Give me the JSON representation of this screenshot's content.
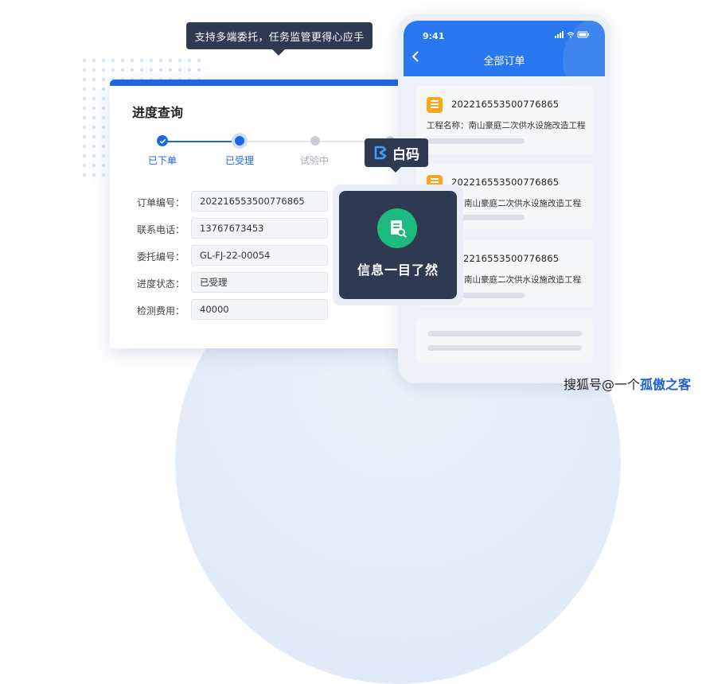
{
  "tooltip": {
    "text": "支持多端委托，任务监管更得心应手"
  },
  "progress_card": {
    "title": "进度查询",
    "steps": [
      {
        "label": "已下单",
        "state": "done"
      },
      {
        "label": "已受理",
        "state": "current"
      },
      {
        "label": "试验中",
        "state": "pending"
      }
    ],
    "fields": [
      {
        "label": "订单编号：",
        "value": "202216553500776865"
      },
      {
        "label": "联系电话：",
        "value": "13767673453"
      },
      {
        "label": "委托编号：",
        "value": "GL-FJ-22-00054"
      },
      {
        "label": "进度状态：",
        "value": "已受理"
      },
      {
        "label": "检测费用：",
        "value": "40000"
      }
    ]
  },
  "brand": {
    "name": "白码"
  },
  "info_card": {
    "text": "信息一目了然",
    "icon": "document-search-icon"
  },
  "phone": {
    "status_time": "9:41",
    "title": "全部订单",
    "orders": [
      {
        "order_no": "202216553500776865",
        "project": "工程名称：南山豪庭二次供水设施改造工程"
      },
      {
        "order_no": "202216553500776865",
        "project": "南山豪庭二次供水设施改造工程"
      },
      {
        "order_no": "202216553500776865",
        "project": "南山豪庭二次供水设施改造工程"
      }
    ]
  },
  "watermark": {
    "prefix": "搜狐号@一个",
    "suffix": "孤傲之客"
  },
  "colors": {
    "accent": "#1f66e5",
    "dark": "#2d3a52",
    "green": "#1dba7d",
    "orange": "#f5a623"
  }
}
